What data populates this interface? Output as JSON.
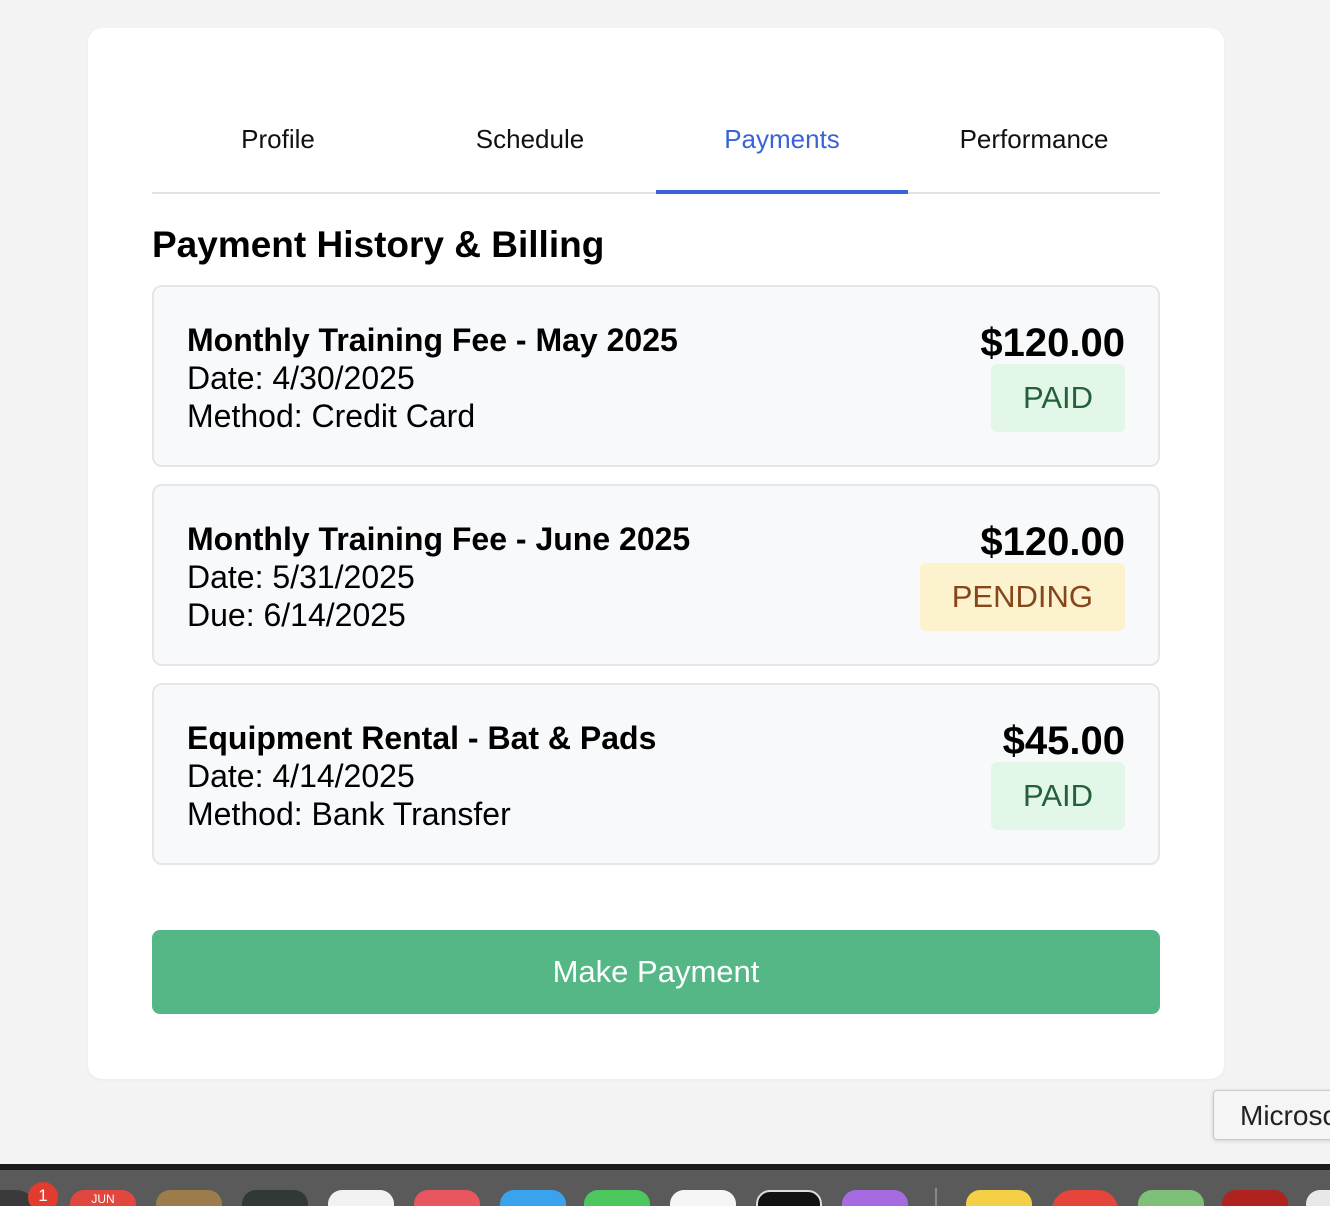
{
  "tabs": [
    {
      "label": "Profile",
      "active": false
    },
    {
      "label": "Schedule",
      "active": false
    },
    {
      "label": "Payments",
      "active": true
    },
    {
      "label": "Performance",
      "active": false
    }
  ],
  "section_title": "Payment History & Billing",
  "payments": [
    {
      "title": "Monthly Training Fee - May 2025",
      "line1": "Date: 4/30/2025",
      "line2": "Method: Credit Card",
      "amount": "$120.00",
      "status": "PAID"
    },
    {
      "title": "Monthly Training Fee - June 2025",
      "line1": "Date: 5/31/2025",
      "line2": "Due: 6/14/2025",
      "amount": "$120.00",
      "status": "PENDING"
    },
    {
      "title": "Equipment Rental - Bat & Pads",
      "line1": "Date: 4/14/2025",
      "line2": "Method: Bank Transfer",
      "amount": "$45.00",
      "status": "PAID"
    }
  ],
  "make_payment_label": "Make Payment",
  "tooltip_text": "Microso",
  "dock": {
    "badge_count": "1",
    "calendar_month": "JUN"
  },
  "colors": {
    "accent": "#3b63d6",
    "button": "#55b786",
    "paid_bg": "#e3f7e9",
    "paid_text": "#23613a",
    "pending_bg": "#fcf2cd",
    "pending_text": "#87451c"
  }
}
